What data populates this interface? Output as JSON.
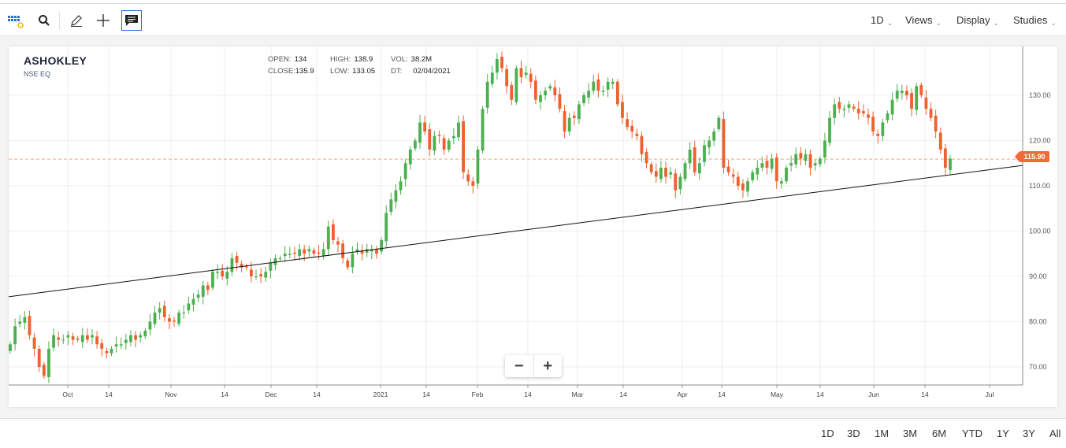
{
  "toolbar": {
    "interval_label": "1D",
    "views_label": "Views",
    "display_label": "Display",
    "studies_label": "Studies",
    "icons": [
      "grid-icon",
      "search-icon",
      "pencil-icon",
      "crosshair-icon",
      "comment-icon"
    ]
  },
  "instrument": {
    "symbol": "ASHOKLEY",
    "exchange": "NSE EQ",
    "open_label": "OPEN:",
    "open": "134",
    "high_label": "HIGH:",
    "high": "138.9",
    "vol_label": "VOL:",
    "vol": "38.2M",
    "close_label": "CLOSE:",
    "close": "135.9",
    "low_label": "LOW:",
    "low": "133.05",
    "dt_label": "DT:",
    "dt": "02/04/2021"
  },
  "last_price": "115.90",
  "range_buttons": [
    "1D",
    "3D",
    "1M",
    "3M",
    "6M",
    "YTD",
    "1Y",
    "3Y",
    "All"
  ],
  "colors": {
    "up": "#4caf50",
    "down": "#f0602e",
    "accent": "#2a6ad9",
    "trend": "#111111"
  },
  "chart_data": {
    "type": "candlestick",
    "y_axis": {
      "ticks": [
        "130.00",
        "120.00",
        "110.00",
        "100.00",
        "90.00",
        "80.00",
        "70.00"
      ],
      "ylim": [
        65,
        140
      ]
    },
    "x_axis": {
      "ticks": [
        "Oct",
        "14",
        "Nov",
        "14",
        "Dec",
        "14",
        "2021",
        "14",
        "Feb",
        "14",
        "Mar",
        "14",
        "Apr",
        "14",
        "May",
        "14",
        "Jun",
        "14",
        "Jul"
      ]
    },
    "closes": [
      75,
      79,
      80,
      81,
      77,
      74,
      70,
      68,
      74,
      77,
      76,
      76,
      77,
      76,
      76,
      77,
      76,
      77,
      75,
      74,
      73,
      74,
      75,
      75,
      76,
      77,
      76,
      77,
      78,
      80,
      82,
      83,
      81,
      80,
      80,
      82,
      82,
      84,
      85,
      86,
      88,
      87,
      91,
      91,
      90,
      91,
      94,
      93,
      92,
      92,
      90,
      90,
      90,
      91,
      93,
      94,
      94,
      95,
      95,
      95,
      96,
      95,
      96,
      95,
      95,
      96,
      101,
      98,
      97,
      94,
      92,
      95,
      96,
      95,
      96,
      96,
      95,
      98,
      104,
      107,
      109,
      111,
      115,
      118,
      120,
      124,
      122,
      118,
      121,
      121,
      118,
      120,
      121,
      124,
      113,
      111,
      110,
      118,
      127,
      133,
      135,
      138,
      136,
      132,
      129,
      136,
      134,
      135,
      133,
      129,
      130,
      131,
      132,
      130,
      127,
      122,
      125,
      125,
      128,
      130,
      131,
      133,
      131,
      131,
      133,
      133,
      128,
      125,
      123,
      122,
      121,
      117,
      115,
      113,
      112,
      114,
      112,
      113,
      109,
      112,
      115,
      118,
      113,
      115,
      119,
      120,
      122,
      125,
      114,
      113,
      112,
      110,
      109,
      111,
      113,
      114,
      115,
      114,
      116,
      111,
      111,
      114,
      115,
      117,
      116,
      117,
      114,
      115,
      116,
      120,
      125,
      128,
      127,
      127,
      128,
      127,
      126,
      126,
      125,
      122,
      121,
      124,
      126,
      129,
      131,
      131,
      130,
      127,
      132,
      130,
      127,
      125,
      122,
      118,
      114,
      116
    ],
    "trend_line": {
      "start": 85.5,
      "end": 114.5
    }
  }
}
